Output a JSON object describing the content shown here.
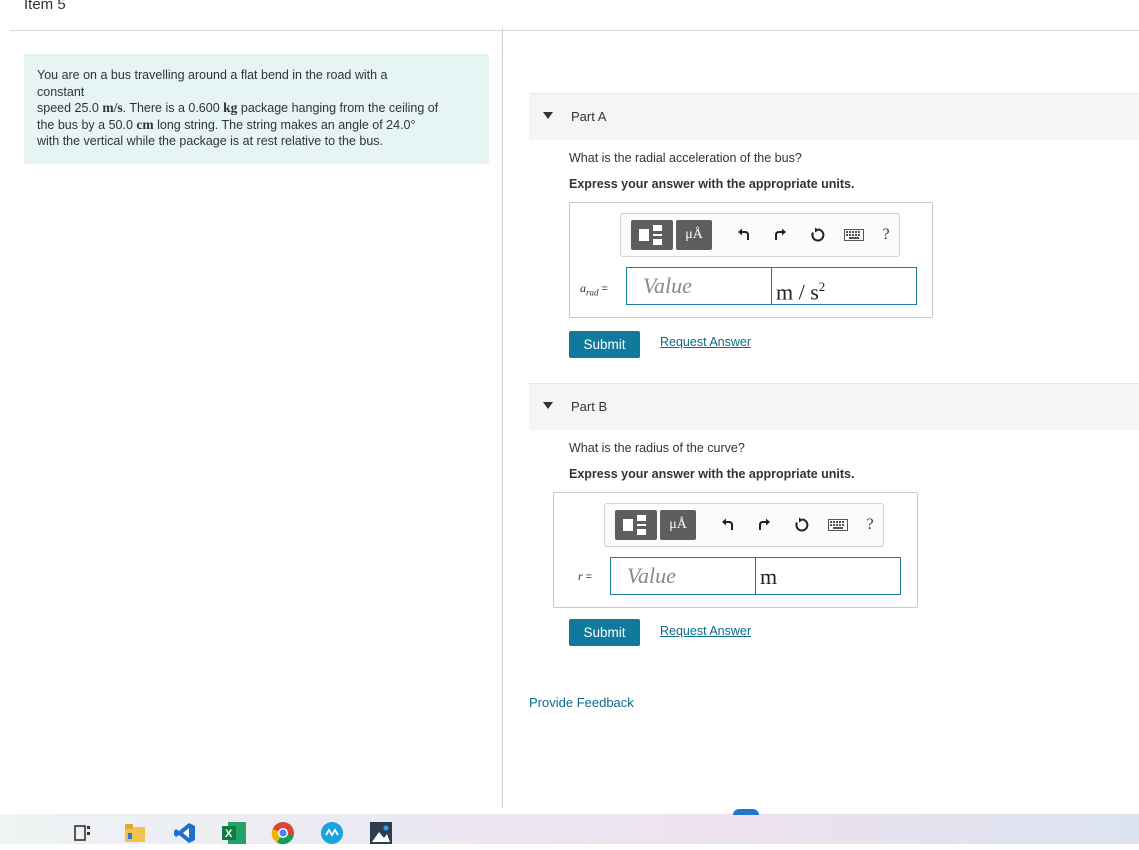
{
  "item": {
    "title": "Item 5"
  },
  "problem": {
    "line1": "You are on a bus travelling around a flat bend in the road with a",
    "line2": "constant",
    "line3_pre": "speed 25.0 ",
    "line3_unit1": "m/s",
    "line3_mid": ". There is a 0.600 ",
    "line3_unit2": "kg",
    "line3_post": " package hanging from the ceiling of",
    "line4_pre": "the bus by a 50.0 ",
    "line4_unit": "cm",
    "line4_post": " long string. The string makes an angle of 24.0°",
    "line5": "with the vertical while the package is at rest relative to the bus."
  },
  "partA": {
    "label": "Part A",
    "question": "What is the radial acceleration of the bus?",
    "instruction": "Express your answer with the appropriate units.",
    "var_symbol": "a",
    "var_sub": "rad",
    "equals": "=",
    "value_placeholder": "Value",
    "unit_text": "m / s",
    "unit_exp": "2",
    "submit": "Submit",
    "request": "Request Answer"
  },
  "partB": {
    "label": "Part B",
    "question": "What is the radius of the curve?",
    "instruction": "Express your answer with the appropriate units.",
    "var_symbol": "r",
    "equals": "=",
    "value_placeholder": "Value",
    "unit_text": "m",
    "submit": "Submit",
    "request": "Request Answer"
  },
  "toolbar": {
    "units_glyph": "μÅ",
    "help": "?"
  },
  "feedback": "Provide Feedback",
  "icons": {
    "template": "templates-icon",
    "units": "units-icon",
    "undo": "undo-icon",
    "redo": "redo-icon",
    "reset": "reset-icon",
    "keyboard": "keyboard-icon",
    "help": "help-icon"
  },
  "taskbar_apps": [
    "task-view",
    "file-explorer",
    "visual-studio",
    "excel",
    "chrome",
    "app",
    "photos"
  ]
}
